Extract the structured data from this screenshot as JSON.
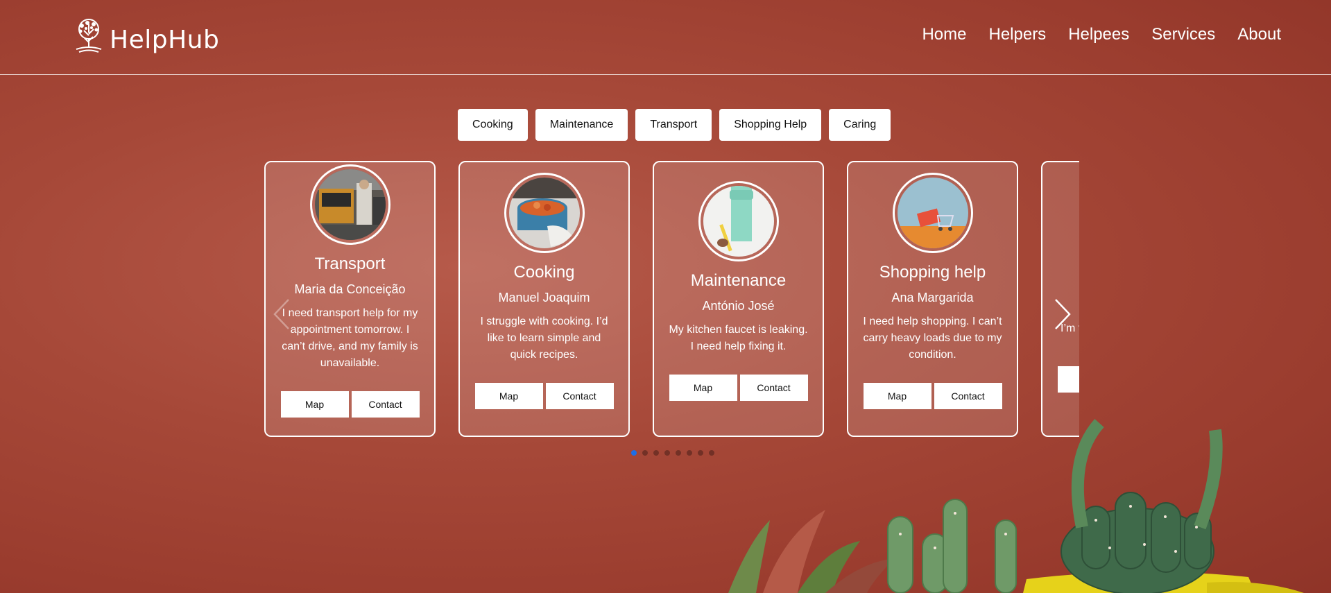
{
  "brand": {
    "name": "HelpHub",
    "logo_icon": "tree-icon"
  },
  "nav": {
    "items": [
      {
        "label": "Home"
      },
      {
        "label": "Helpers"
      },
      {
        "label": "Helpees"
      },
      {
        "label": "Services"
      },
      {
        "label": "About"
      }
    ]
  },
  "filters": [
    {
      "label": "Cooking"
    },
    {
      "label": "Maintenance"
    },
    {
      "label": "Transport"
    },
    {
      "label": "Shopping Help"
    },
    {
      "label": "Caring"
    }
  ],
  "cards": [
    {
      "title": "Transport",
      "name": "Maria da Conceição",
      "description": "I need transport help for my appointment tomorrow. I can’t drive, and my family is unavailable.",
      "image": "bus-photo",
      "map_label": "Map",
      "contact_label": "Contact"
    },
    {
      "title": "Cooking",
      "name": "Manuel Joaquim",
      "description": "I struggle with cooking. I’d like to learn simple and quick recipes.",
      "image": "cooking-pot-photo",
      "map_label": "Map",
      "contact_label": "Contact"
    },
    {
      "title": "Maintenance",
      "name": "António José",
      "description": "My kitchen faucet is leaking. I need help fixing it.",
      "image": "paint-roller-photo",
      "map_label": "Map",
      "contact_label": "Contact"
    },
    {
      "title": "Shopping help",
      "name": "Ana Margarida",
      "description": "I need help shopping. I can’t carry heavy loads due to my condition.",
      "image": "shopping-cart-photo",
      "map_label": "Map",
      "contact_label": "Contact"
    },
    {
      "title": "",
      "name": "",
      "description": "I’m t... da...",
      "image": "",
      "map_label": "",
      "contact_label": ""
    }
  ],
  "carousel": {
    "prev_icon": "chevron-left-icon",
    "next_icon": "chevron-right-icon",
    "page_count": 8,
    "active_page": 1
  },
  "colors": {
    "background": "#a64838",
    "accent_dot": "#1e6ee6"
  }
}
